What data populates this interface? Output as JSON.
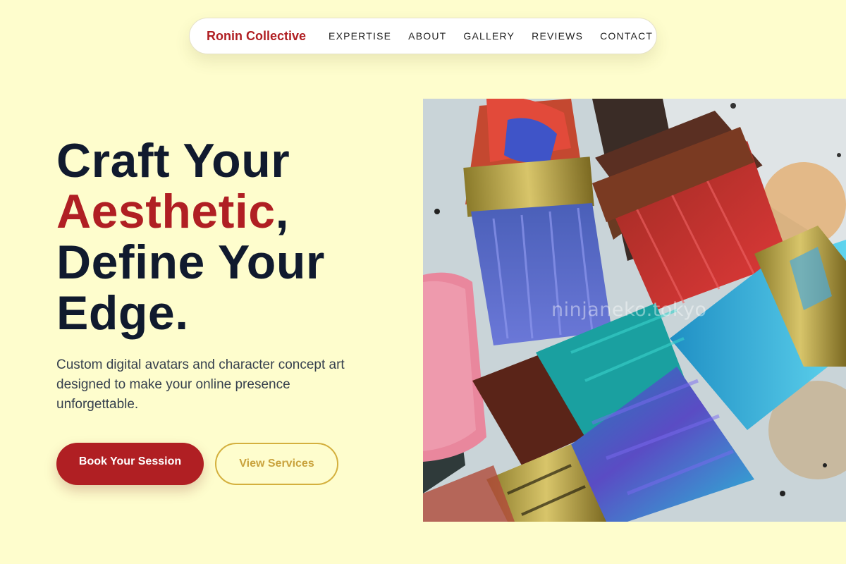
{
  "nav": {
    "brand": "Ronin Collective",
    "links": [
      "EXPERTISE",
      "ABOUT",
      "GALLERY",
      "REVIEWS",
      "CONTACT"
    ]
  },
  "hero": {
    "headline_part1": "Craft Your",
    "headline_accent": "Aesthetic",
    "headline_comma": ",",
    "headline_part2": "Define Your",
    "headline_part3": "Edge.",
    "subtitle": "Custom digital avatars and character concept art designed to make your online presence unforgettable.",
    "primary_cta": "Book Your Session",
    "secondary_cta": "View Services",
    "image_watermark": "ninjaneko.tokyo"
  },
  "colors": {
    "background": "#fefdcd",
    "accent": "#b01f23",
    "heading": "#101a2e",
    "gold": "#d4b03e"
  }
}
